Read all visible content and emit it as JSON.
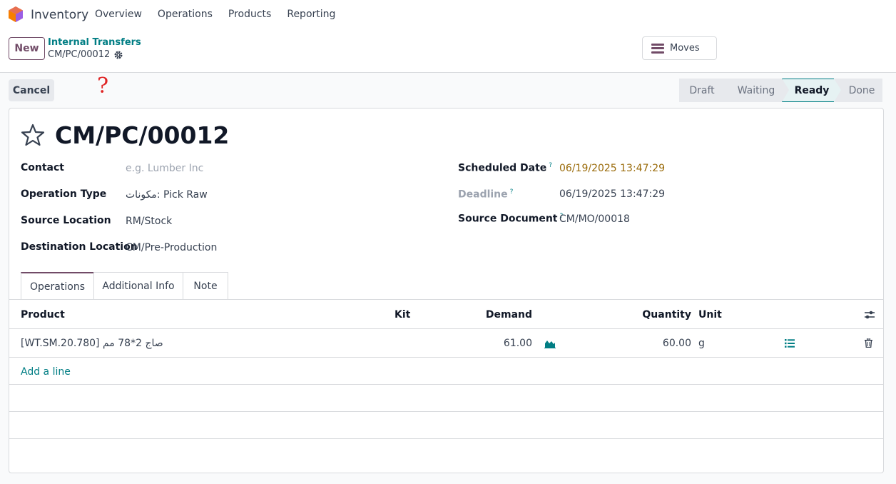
{
  "nav": {
    "app_title": "Inventory",
    "menu": [
      "Overview",
      "Operations",
      "Products",
      "Reporting"
    ]
  },
  "control": {
    "new_label": "New",
    "breadcrumb_parent": "Internal Transfers",
    "breadcrumb_current": "CM/PC/00012",
    "moves_label": "Moves"
  },
  "actions": {
    "cancel_label": "Cancel",
    "annotation_mark": "?"
  },
  "statusbar": {
    "stages": [
      "Draft",
      "Waiting",
      "Ready",
      "Done"
    ],
    "active": "Ready"
  },
  "record": {
    "name": "CM/PC/00012",
    "contact_label": "Contact",
    "contact_placeholder": "e.g. Lumber Inc",
    "operation_type_label": "Operation Type",
    "operation_type_value": "مكونات: Pick Raw",
    "source_location_label": "Source Location",
    "source_location_value": "RM/Stock",
    "destination_location_label": "Destination Location",
    "destination_location_value": "CM/Pre-Production",
    "scheduled_date_label": "Scheduled Date",
    "scheduled_date_value": "06/19/2025 13:47:29",
    "deadline_label": "Deadline",
    "deadline_value": "06/19/2025 13:47:29",
    "source_document_label": "Source Document",
    "source_document_value": "CM/MO/00018",
    "help_mark": "?"
  },
  "tabs": [
    "Operations",
    "Additional Info",
    "Note"
  ],
  "table": {
    "headers": {
      "product": "Product",
      "kit": "Kit",
      "demand": "Demand",
      "quantity": "Quantity",
      "unit": "Unit"
    },
    "rows": [
      {
        "product": "[WT.SM.20.780] صاج 2*78 مم",
        "demand": "61.00",
        "quantity": "60.00",
        "unit": "g"
      }
    ],
    "add_line_label": "Add a line"
  },
  "colors": {
    "brand": "#714b67",
    "accent": "#017e84",
    "warning": "#9a6b0a"
  }
}
